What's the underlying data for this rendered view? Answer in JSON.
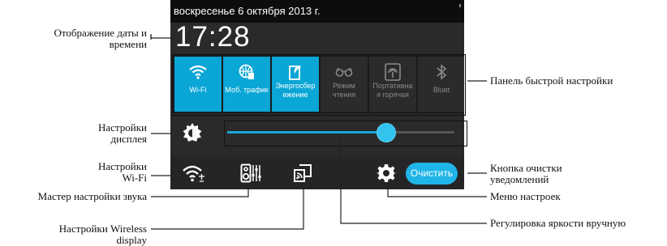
{
  "status_bar": {
    "date": "воскресенье 6 октября 2013 г."
  },
  "clock": {
    "time": "17:28"
  },
  "quick_settings": {
    "tiles": [
      {
        "label": "Wi-Fi",
        "icon": "wifi-icon",
        "active": true
      },
      {
        "label": "Моб. трафик",
        "icon": "mobile-data-icon",
        "active": true
      },
      {
        "label_lines": [
          "Энергосбер",
          "ежение"
        ],
        "icon": "power-saving-icon",
        "active": true
      },
      {
        "label_lines": [
          "Режим",
          "чтения"
        ],
        "icon": "reading-mode-icon",
        "active": false
      },
      {
        "label_lines": [
          "Портативна",
          "я горячая"
        ],
        "icon": "hotspot-icon",
        "active": false
      },
      {
        "label": "Bluet",
        "icon": "bluetooth-icon",
        "active": false
      }
    ]
  },
  "brightness": {
    "level_percent": 70,
    "icon": "brightness-icon"
  },
  "bottom_bar": {
    "icons": [
      "wifi-settings-icon",
      "sound-wizard-icon",
      "wireless-display-icon",
      "settings-gear-icon"
    ],
    "clear_button": "Очистить"
  },
  "annotations": {
    "date_time": [
      "Отображение даты и",
      "времени"
    ],
    "display_settings": [
      "Настройки",
      "дисплея"
    ],
    "wifi_settings": [
      "Настройки",
      "Wi-Fi"
    ],
    "sound_wizard": "Мастер настройки звука",
    "wireless_display": [
      "Настройки Wireless",
      "display"
    ],
    "quick_settings_panel": "Панель быстрой настройки",
    "clear_button": [
      "Кнопка очистки",
      "уведомлений"
    ],
    "settings_menu": "Меню настроек",
    "brightness_manual": "Регулировка яркости вручную"
  },
  "colors": {
    "accent": "#0aa6d6",
    "thumb": "#33c4ee",
    "panel": "#2a2a2c"
  }
}
